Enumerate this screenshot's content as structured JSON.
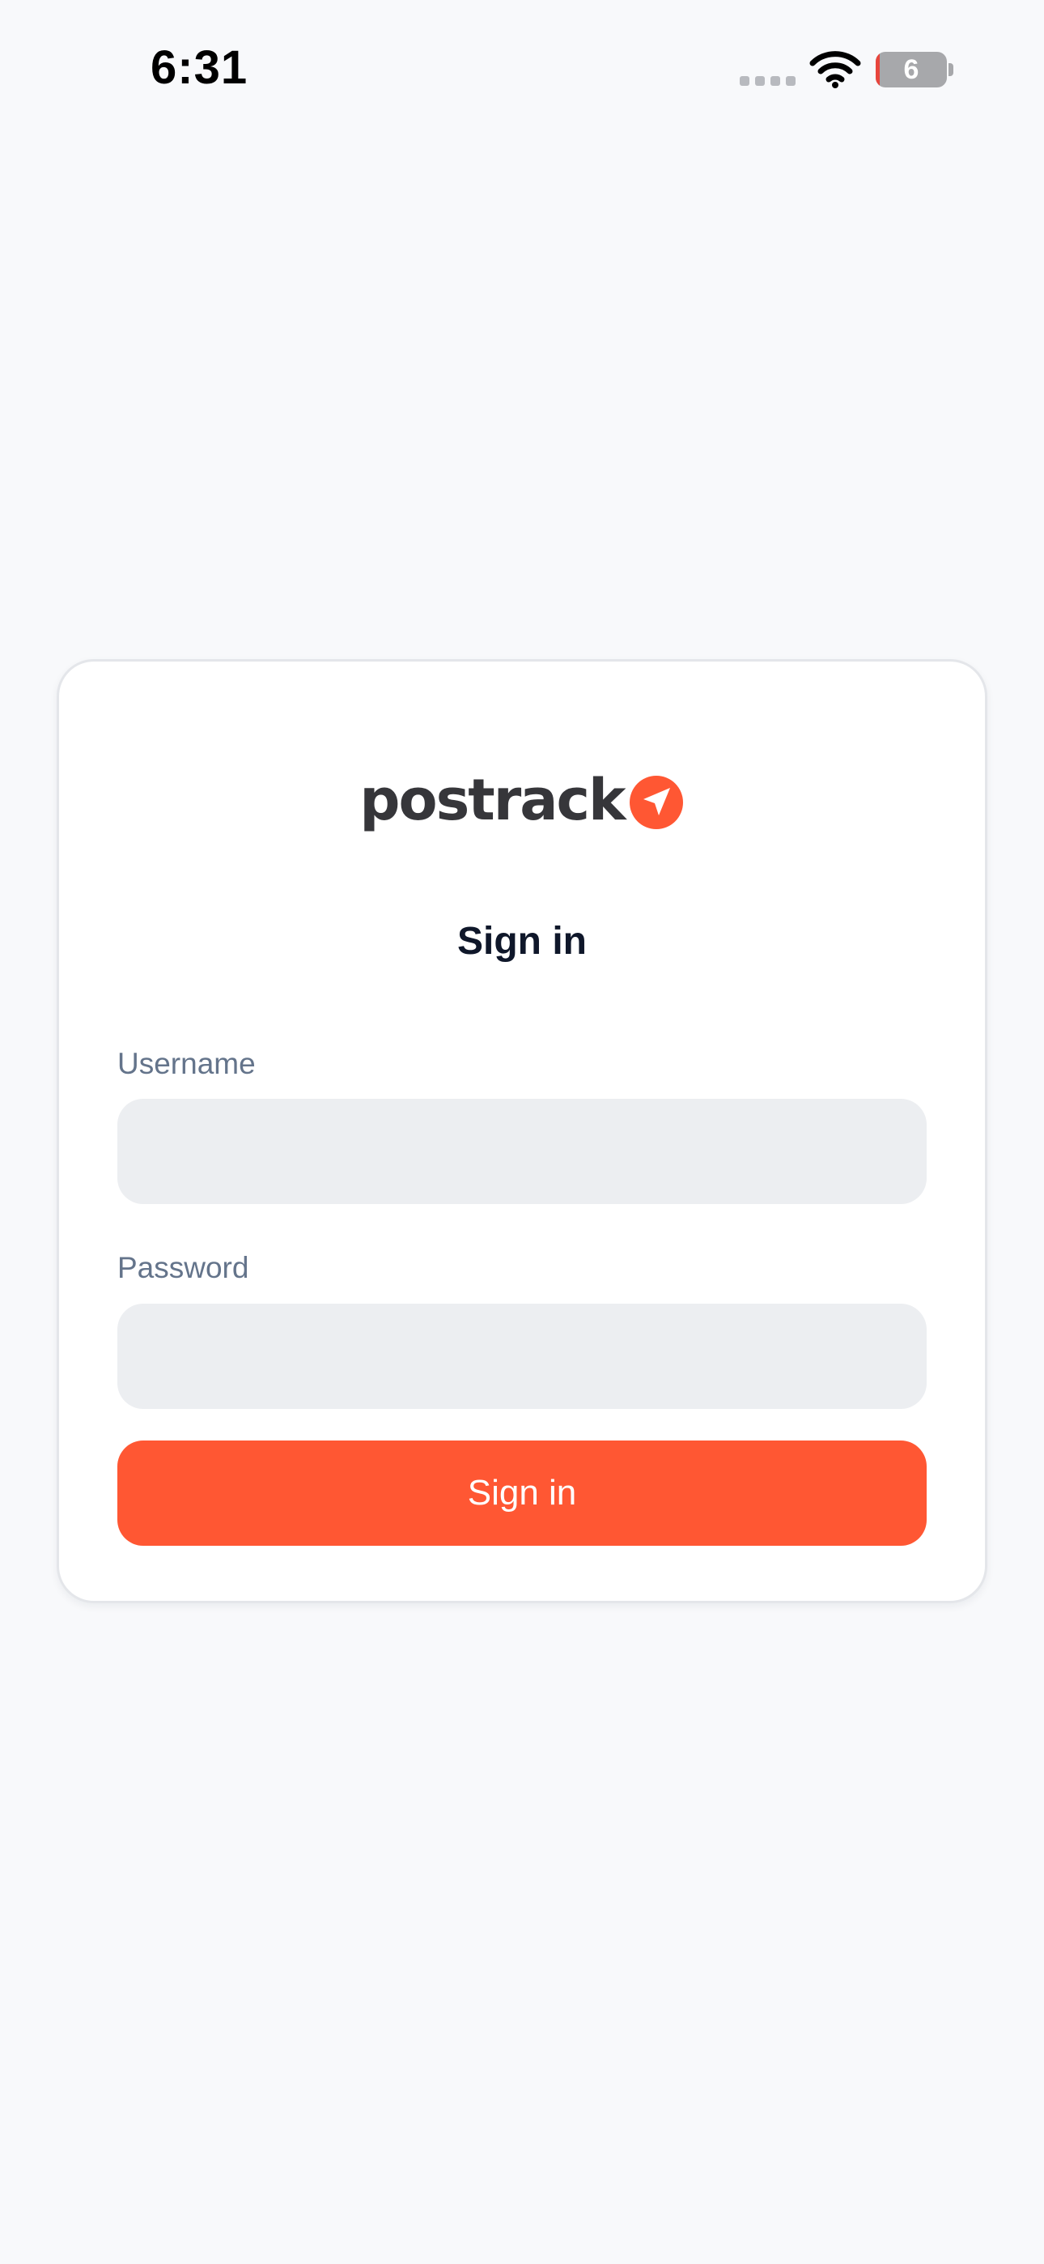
{
  "status_bar": {
    "time": "6:31",
    "battery_percent": "6",
    "battery_level": 0.06,
    "signal_icon": "cellular-signal-icon",
    "wifi_icon": "wifi-icon",
    "battery_icon": "battery-icon"
  },
  "login": {
    "logo_text": "postrack",
    "logo_icon": "navigation-arrow-icon",
    "title": "Sign in",
    "username_label": "Username",
    "username_value": "",
    "password_label": "Password",
    "password_value": "",
    "submit_label": "Sign in"
  },
  "colors": {
    "accent": "#ff5733",
    "background": "#f8f9fb",
    "card": "#ffffff",
    "input_fill": "#eceef1",
    "label": "#64748b",
    "title": "#0f172a",
    "logo_text": "#36363a"
  }
}
